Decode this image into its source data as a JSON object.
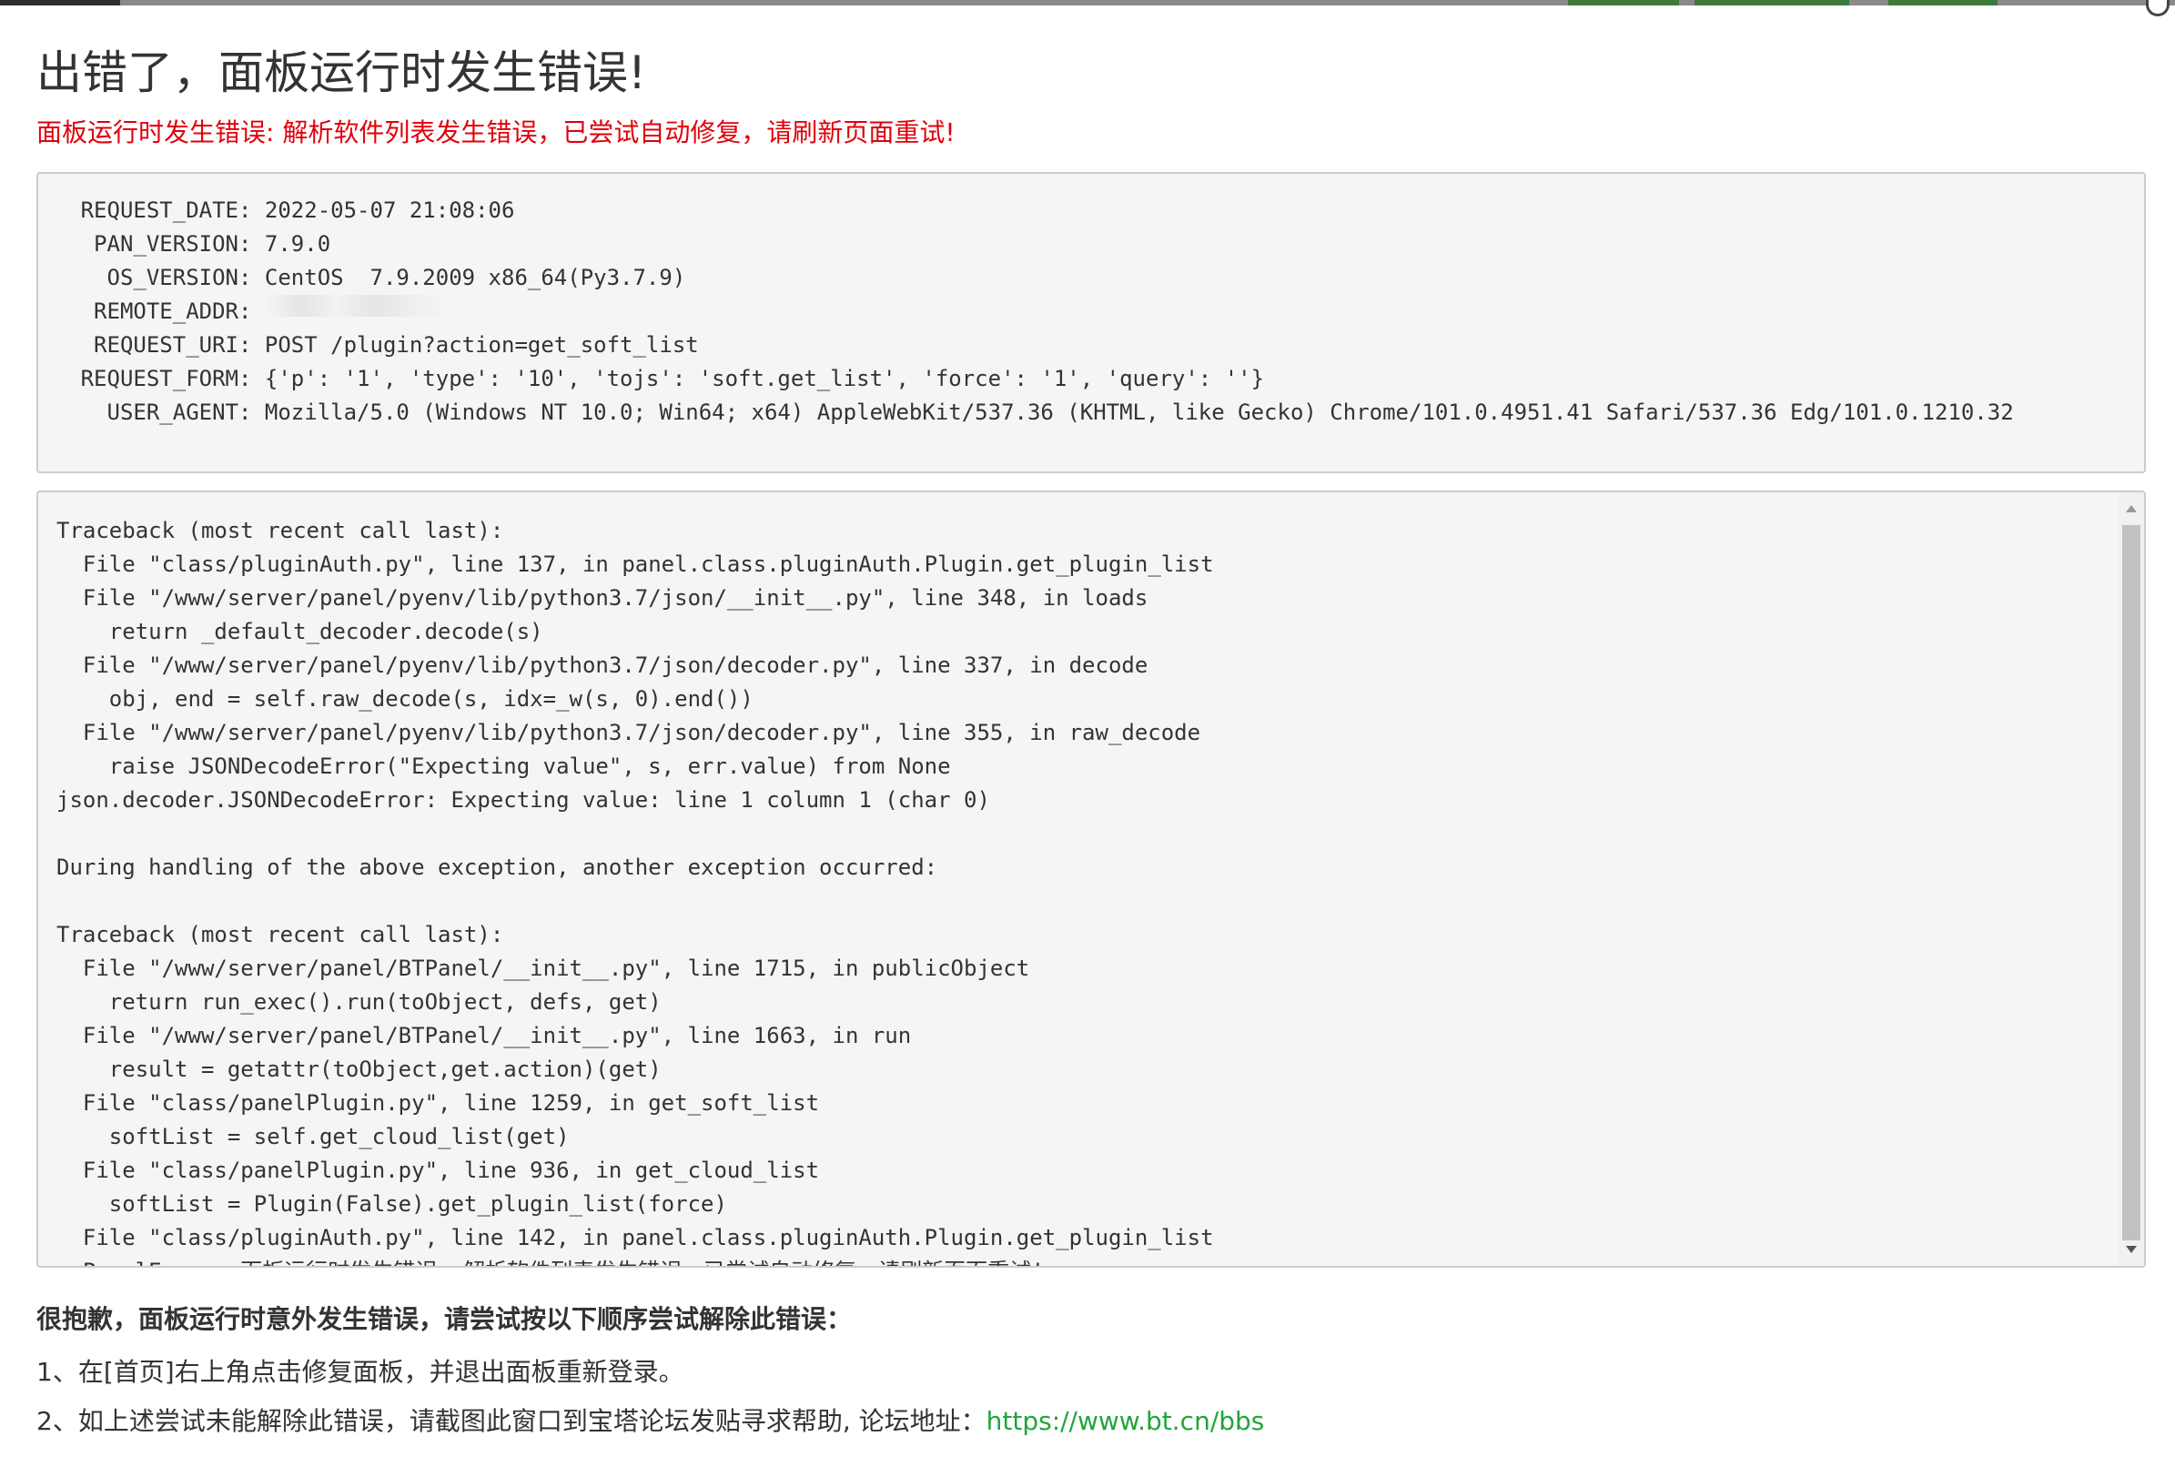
{
  "colors": {
    "error_red": "#e0000b",
    "link_green": "#20a53a",
    "box_bg": "#f5f5f5"
  },
  "page": {
    "title": "出错了，面板运行时发生错误!",
    "error_message": "面板运行时发生错误: 解析软件列表发生错误，已尝试自动修复，请刷新页面重试!"
  },
  "request_info": {
    "rows": [
      {
        "key": "REQUEST_DATE",
        "value": "2022-05-07 21:08:06"
      },
      {
        "key": "PAN_VERSION",
        "value": "7.9.0"
      },
      {
        "key": "OS_VERSION",
        "value": "CentOS  7.9.2009 x86_64(Py3.7.9)"
      },
      {
        "key": "REMOTE_ADDR",
        "value": ""
      },
      {
        "key": "REQUEST_URI",
        "value": "POST /plugin?action=get_soft_list"
      },
      {
        "key": "REQUEST_FORM",
        "value": "{'p': '1', 'type': '10', 'tojs': 'soft.get_list', 'force': '1', 'query': ''}"
      },
      {
        "key": "USER_AGENT",
        "value": "Mozilla/5.0 (Windows NT 10.0; Win64; x64) AppleWebKit/537.36 (KHTML, like Gecko) Chrome/101.0.4951.41 Safari/537.36 Edg/101.0.1210.32"
      }
    ]
  },
  "traceback": {
    "lines": [
      "Traceback (most recent call last):",
      "  File \"class/pluginAuth.py\", line 137, in panel.class.pluginAuth.Plugin.get_plugin_list",
      "  File \"/www/server/panel/pyenv/lib/python3.7/json/__init__.py\", line 348, in loads",
      "    return _default_decoder.decode(s)",
      "  File \"/www/server/panel/pyenv/lib/python3.7/json/decoder.py\", line 337, in decode",
      "    obj, end = self.raw_decode(s, idx=_w(s, 0).end())",
      "  File \"/www/server/panel/pyenv/lib/python3.7/json/decoder.py\", line 355, in raw_decode",
      "    raise JSONDecodeError(\"Expecting value\", s, err.value) from None",
      "json.decoder.JSONDecodeError: Expecting value: line 1 column 1 (char 0)",
      "",
      "During handling of the above exception, another exception occurred:",
      "",
      "Traceback (most recent call last):",
      "  File \"/www/server/panel/BTPanel/__init__.py\", line 1715, in publicObject",
      "    return run_exec().run(toObject, defs, get)",
      "  File \"/www/server/panel/BTPanel/__init__.py\", line 1663, in run",
      "    result = getattr(toObject,get.action)(get)",
      "  File \"class/panelPlugin.py\", line 1259, in get_soft_list",
      "    softList = self.get_cloud_list(get)",
      "  File \"class/panelPlugin.py\", line 936, in get_cloud_list",
      "    softList = Plugin(False).get_plugin_list(force)",
      "  File \"class/pluginAuth.py\", line 142, in panel.class.pluginAuth.Plugin.get_plugin_list",
      "  PanelError: 面板运行时发生错误: 解析软件列表发生错误，已尝试自动修复，请刷新页面重试!"
    ]
  },
  "help": {
    "title": "很抱歉，面板运行时意外发生错误，请尝试按以下顺序尝试解除此错误：",
    "step1": "1、在[首页]右上角点击修复面板，并退出面板重新登录。",
    "step2_text": "2、如上述尝试未能解除此错误，请截图此窗口到宝塔论坛发贴寻求帮助, 论坛地址：",
    "forum_link": "https://www.bt.cn/bbs"
  }
}
